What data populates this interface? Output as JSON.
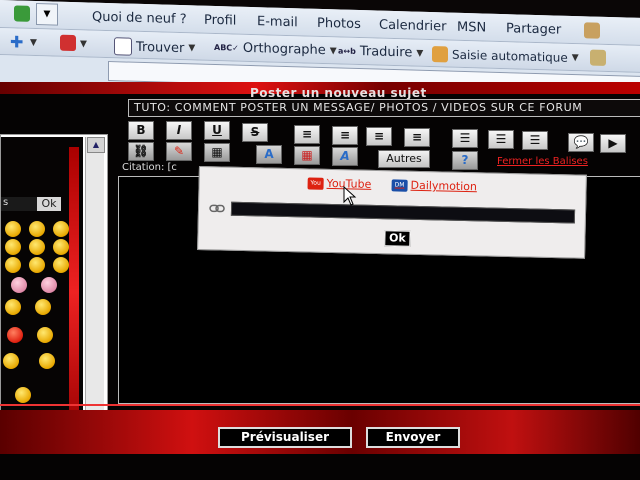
{
  "browser_toolbar": {
    "menu_items": [
      "Quoi de neuf ?",
      "Profil",
      "E-mail",
      "Photos",
      "Calendrier",
      "MSN",
      "Partager"
    ],
    "tools": [
      {
        "label": "Trouver",
        "icon": "magnifier-icon"
      },
      {
        "label": "Orthographe",
        "icon": "spellcheck-icon"
      },
      {
        "label": "Traduire",
        "icon": "translate-icon"
      },
      {
        "label": "Saisie automatique",
        "icon": "autofill-icon"
      }
    ]
  },
  "forum": {
    "page_title": "Poster un nouveau sujet",
    "subject_value": "TUTO: COMMENT POSTER UN MESSAGE/ PHOTOS / VIDEOS SUR CE FORUM",
    "smiley_select_value": "s",
    "smiley_ok_label": "Ok",
    "autres_label": "Autres",
    "fermer_balises_label": "Fermer les Balises",
    "citation_label": "Citation: [c",
    "preview_button": "Prévisualiser",
    "send_button": "Envoyer"
  },
  "video_dialog": {
    "youtube_label": "YouTube",
    "dailymotion_label": "Dailymotion",
    "url_value": "",
    "ok_label": "Ok"
  },
  "colors": {
    "accent_red": "#d21111",
    "background": "#050303",
    "toolbar": "#dce5f0"
  }
}
